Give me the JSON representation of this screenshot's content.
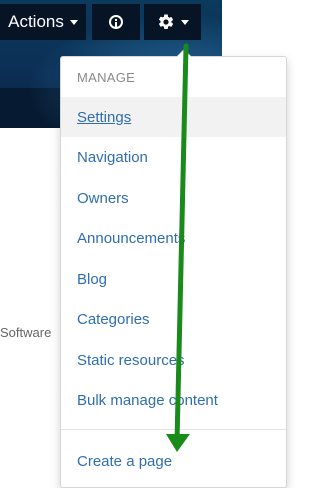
{
  "toolbar": {
    "actions_label": "Actions",
    "info_icon": "info-circle-icon",
    "settings_icon": "gear-icon"
  },
  "background": {
    "partial_text": "Software"
  },
  "menu": {
    "header": "MANAGE",
    "items": [
      {
        "label": "Settings",
        "active": true
      },
      {
        "label": "Navigation"
      },
      {
        "label": "Owners"
      },
      {
        "label": "Announcements"
      },
      {
        "label": "Blog"
      },
      {
        "label": "Categories"
      },
      {
        "label": "Static resources"
      },
      {
        "label": "Bulk manage content"
      }
    ],
    "footer_items": [
      {
        "label": "Create a page"
      }
    ]
  },
  "colors": {
    "banner": "#0c2f55",
    "button_bg": "#061426",
    "link": "#2f6eb0",
    "annotation_arrow": "#1a8a1a"
  }
}
